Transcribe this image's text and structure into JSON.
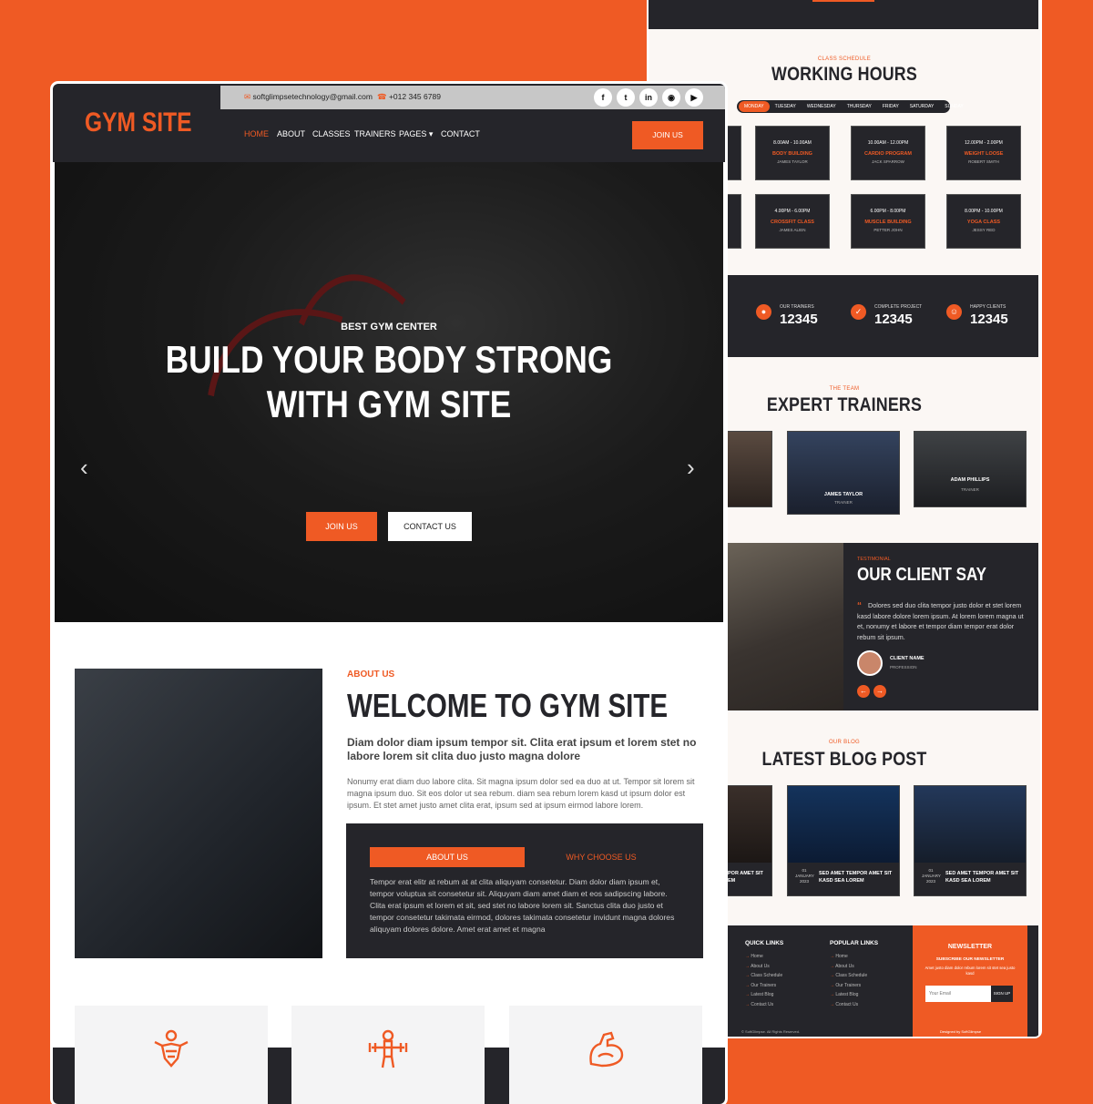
{
  "left": {
    "logo": "GYM SITE",
    "topbar": {
      "email": "softglimpsetechnology@gmail.com",
      "phone": "+012 345 6789",
      "social": [
        "facebook-icon",
        "twitter-icon",
        "linkedin-icon",
        "instagram-icon",
        "youtube-icon"
      ]
    },
    "nav": {
      "home": "HOME",
      "about": "ABOUT",
      "classes": "CLASSES",
      "trainers": "TRAINERS",
      "pages": "PAGES",
      "contact": "CONTACT",
      "join": "JOIN US"
    },
    "hero": {
      "subtitle": "BEST GYM CENTER",
      "title_line1": "BUILD YOUR BODY STRONG",
      "title_line2": "WITH GYM SITE",
      "btn_join": "JOIN US",
      "btn_contact": "CONTACT US"
    },
    "about": {
      "subtitle": "ABOUT US",
      "title": "WELCOME TO GYM SITE",
      "lead": "Diam dolor diam ipsum tempor sit. Clita erat ipsum et lorem stet no labore lorem sit clita duo justo magna dolore",
      "paragraph": "Nonumy erat diam duo labore clita. Sit magna ipsum dolor sed ea duo at ut. Tempor sit lorem sit magna ipsum duo. Sit eos dolor ut sea rebum. diam sea rebum lorem kasd ut ipsum dolor est ipsum. Et stet amet justo amet clita erat, ipsum sed at ipsum eirmod labore lorem.",
      "tab_about": "ABOUT US",
      "tab_why": "WHY CHOOSE US",
      "tab_text": "Tempor erat elitr at rebum at at clita aliquyam consetetur. Diam dolor diam ipsum et, tempor voluptua sit consetetur sit. Aliquyam diam amet diam et eos sadipscing labore. Clita erat ipsum et lorem et sit, sed stet no labore lorem sit. Sanctus clita duo justo et tempor consetetur takimata eirmod, dolores takimata consetetur invidunt magna dolores aliquyam dolores dolore. Amet erat amet et magna"
    },
    "features": [
      "body-building-icon",
      "weight-lifting-icon",
      "muscle-building-icon"
    ]
  },
  "right": {
    "schedule": {
      "subtitle": "CLASS SCHEDULE",
      "title": "WORKING HOURS",
      "days": [
        "MONDAY",
        "TUESDAY",
        "WEDNESDAY",
        "THURSDAY",
        "FRIDAY",
        "SATURDAY",
        "SUNDAY"
      ],
      "slots": [
        {
          "time": "8.00AM - 10.00AM",
          "class": "BODY BUILDING",
          "trainer": "JAMES TAYLOR"
        },
        {
          "time": "10.00AM - 12.00PM",
          "class": "CARDIO PROGRAM",
          "trainer": "JACK SPARROW"
        },
        {
          "time": "12.00PM - 2.00PM",
          "class": "WEIGHT LOOSE",
          "trainer": "ROBERT SMITH"
        },
        {
          "time": "4.00PM - 6.00PM",
          "class": "CROSSFIT CLASS",
          "trainer": "JAMES ALIEN"
        },
        {
          "time": "6.00PM - 8.00PM",
          "class": "MUSCLE BUILDING",
          "trainer": "PETTER JOHN"
        },
        {
          "time": "8.00PM - 10.00PM",
          "class": "YOGA CLASS",
          "trainer": "JESSY RED"
        }
      ]
    },
    "stats": [
      {
        "label": "OUR TRAINERS",
        "value": "12345"
      },
      {
        "label": "COMPLETE PROJECT",
        "value": "12345"
      },
      {
        "label": "HAPPY CLIENTS",
        "value": "12345"
      }
    ],
    "team": {
      "subtitle": "THE TEAM",
      "title": "EXPERT TRAINERS",
      "members": [
        {
          "name": "JAMES TAYLOR",
          "role": "TRAINER"
        },
        {
          "name": "ADAM PHILLIPS",
          "role": "TRAINER"
        }
      ]
    },
    "testimonial": {
      "subtitle": "TESTIMONIAL",
      "title": "OUR CLIENT SAY",
      "quote": "Dolores sed duo clita tempor justo dolor et stet lorem kasd labore dolore lorem ipsum. At lorem lorem magna ut et, nonumy et labore et tempor diam tempor erat dolor rebum sit ipsum.",
      "client": "CLIENT NAME",
      "profession": "PROFESSION"
    },
    "blog": {
      "subtitle": "OUR BLOG",
      "title": "LATEST BLOG POST",
      "partial": "POR AMET SIT",
      "partial2": "EM",
      "posts": [
        {
          "day": "01",
          "month": "JANUARY",
          "year": "2023",
          "title": "SED AMET TEMPOR AMET SIT KASD SEA LOREM"
        },
        {
          "day": "01",
          "month": "JANUARY",
          "year": "2023",
          "title": "SED AMET TEMPOR AMET SIT KASD SEA LOREM"
        }
      ]
    },
    "footer": {
      "quick_title": "QUICK LINKS",
      "quick": [
        "Home",
        "About Us",
        "Class Schedule",
        "Our Trainers",
        "Latest Blog",
        "Contact Us"
      ],
      "popular_title": "POPULAR LINKS",
      "popular": [
        "Home",
        "About Us",
        "Class Schedule",
        "Our Trainers",
        "Latest Blog",
        "Contact Us"
      ],
      "newsletter_title": "NEWSLETTER",
      "newsletter_sub": "SUBSCRIBE OUR NEWSLETTER",
      "newsletter_text": "Amet justo diam dolor rebum lorem sit stet sea justo kasd",
      "email_placeholder": "Your Email",
      "signup": "SIGN UP",
      "copyright": "© SoftGlimpse. All Rights Reserved.",
      "designed": "Designed by SoftGlimpse"
    }
  }
}
